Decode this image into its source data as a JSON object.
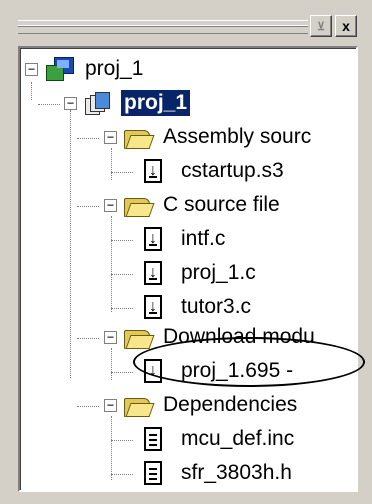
{
  "panel": {
    "pin_glyph": "⊻",
    "close_glyph": "x"
  },
  "tree": {
    "root": {
      "label": "proj_1",
      "expander": "−"
    },
    "project": {
      "label": "proj_1",
      "expander": "−"
    },
    "folders": [
      {
        "label": "Assembly sourc",
        "expander": "−",
        "files": [
          {
            "label": "cstartup.s3",
            "icon": "download-file-icon"
          }
        ]
      },
      {
        "label": "C source file",
        "expander": "−",
        "files": [
          {
            "label": "intf.c",
            "icon": "download-file-icon"
          },
          {
            "label": "proj_1.c",
            "icon": "download-file-icon"
          },
          {
            "label": "tutor3.c",
            "icon": "download-file-icon"
          }
        ]
      },
      {
        "label": "Download modu",
        "expander": "−",
        "files": [
          {
            "label": "proj_1.695 -",
            "icon": "download-arrow-file-icon"
          }
        ]
      },
      {
        "label": "Dependencies",
        "expander": "−",
        "files": [
          {
            "label": "mcu_def.inc",
            "icon": "text-file-icon"
          },
          {
            "label": "sfr_3803h.h",
            "icon": "text-file-icon"
          }
        ]
      }
    ]
  },
  "colors": {
    "selection_bg": "#0a246a",
    "selection_fg": "#ffffff",
    "window_bg": "#d4d0c8"
  }
}
